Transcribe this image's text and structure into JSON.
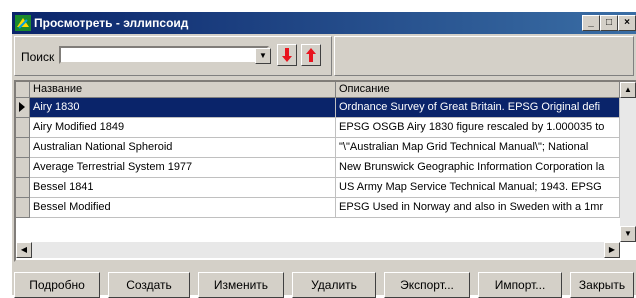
{
  "window": {
    "title": "Просмотреть - эллипсоид"
  },
  "title_buttons": {
    "minimize": "_",
    "maximize": "□",
    "close": "×"
  },
  "search": {
    "label": "Поиск",
    "value": ""
  },
  "table": {
    "headers": [
      "Название",
      "Описание"
    ],
    "selected_row": 0,
    "rows": [
      {
        "name": "Airy 1830",
        "desc": "Ordnance Survey of Great Britain. EPSG Original defi"
      },
      {
        "name": "Airy Modified 1849",
        "desc": "EPSG OSGB Airy 1830 figure rescaled by 1.000035 to"
      },
      {
        "name": "Australian National Spheroid",
        "desc": "\"\\\"Australian Map Grid Technical Manual\\\"; National"
      },
      {
        "name": "Average Terrestrial System 1977",
        "desc": "New Brunswick Geographic Information Corporation la"
      },
      {
        "name": "Bessel 1841",
        "desc": "US Army Map Service Technical Manual; 1943. EPSG"
      },
      {
        "name": "Bessel Modified",
        "desc": "EPSG Used in Norway and also in Sweden with a 1mr"
      }
    ]
  },
  "buttons": {
    "details": "Подробно",
    "create": "Создать",
    "edit": "Изменить",
    "delete": "Удалить",
    "export": "Экспорт...",
    "import": "Импорт...",
    "close": "Закрыть"
  },
  "colors": {
    "title_bar": "#0a246a",
    "selection": "#0a246a",
    "arrow_red": "#e8141e"
  }
}
